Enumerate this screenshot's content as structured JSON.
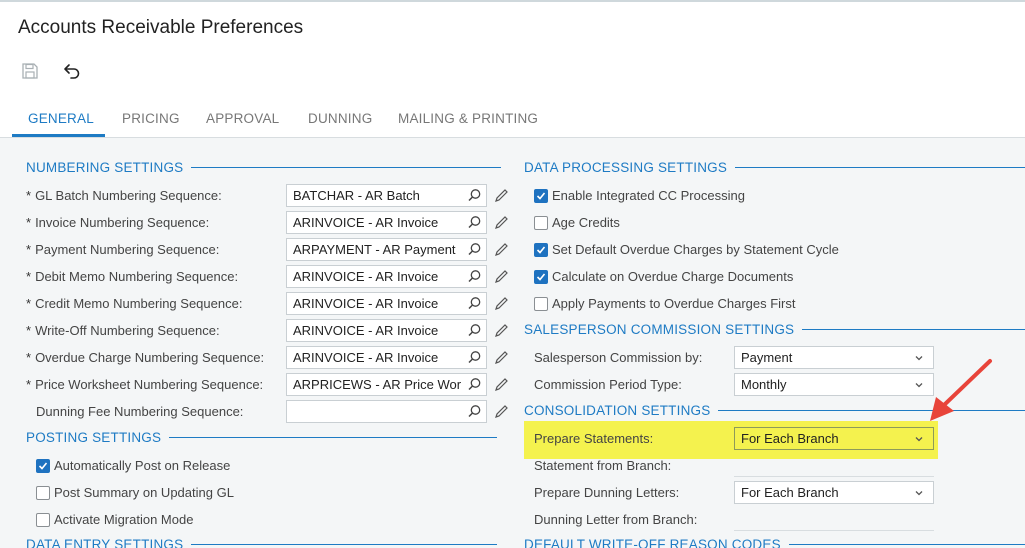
{
  "page": {
    "title": "Accounts Receivable Preferences"
  },
  "toolbar": {
    "save_icon": "save-icon",
    "undo_icon": "undo-icon"
  },
  "tabs": [
    {
      "label": "GENERAL",
      "active": true
    },
    {
      "label": "PRICING",
      "active": false
    },
    {
      "label": "APPROVAL",
      "active": false
    },
    {
      "label": "DUNNING",
      "active": false
    },
    {
      "label": "MAILING & PRINTING",
      "active": false
    }
  ],
  "numbering": {
    "title": "NUMBERING SETTINGS",
    "required_marker": "*",
    "rows": [
      {
        "label": "GL Batch Numbering Sequence:",
        "value": "BATCHAR - AR Batch",
        "required": true
      },
      {
        "label": "Invoice Numbering Sequence:",
        "value": "ARINVOICE - AR Invoice",
        "required": true
      },
      {
        "label": "Payment Numbering Sequence:",
        "value": "ARPAYMENT - AR Payment",
        "required": true
      },
      {
        "label": "Debit Memo Numbering Sequence:",
        "value": "ARINVOICE - AR Invoice",
        "required": true
      },
      {
        "label": "Credit Memo Numbering Sequence:",
        "value": "ARINVOICE - AR Invoice",
        "required": true
      },
      {
        "label": "Write-Off Numbering Sequence:",
        "value": "ARINVOICE - AR Invoice",
        "required": true
      },
      {
        "label": "Overdue Charge Numbering Sequence:",
        "value": "ARINVOICE - AR Invoice",
        "required": true
      },
      {
        "label": "Price Worksheet Numbering Sequence:",
        "value": "ARPRICEWS - AR Price Wor",
        "required": true
      },
      {
        "label": "Dunning Fee Numbering Sequence:",
        "value": "",
        "required": false
      }
    ]
  },
  "posting": {
    "title": "POSTING SETTINGS",
    "items": [
      {
        "label": "Automatically Post on Release",
        "checked": true
      },
      {
        "label": "Post Summary on Updating GL",
        "checked": false
      },
      {
        "label": "Activate Migration Mode",
        "checked": false
      }
    ]
  },
  "data_entry": {
    "title": "DATA ENTRY SETTINGS"
  },
  "data_processing": {
    "title": "DATA PROCESSING SETTINGS",
    "items": [
      {
        "label": "Enable Integrated CC Processing",
        "checked": true
      },
      {
        "label": "Age Credits",
        "checked": false
      },
      {
        "label": "Set Default Overdue Charges by Statement Cycle",
        "checked": true
      },
      {
        "label": "Calculate on Overdue Charge Documents",
        "checked": true
      },
      {
        "label": "Apply Payments to Overdue Charges First",
        "checked": false
      }
    ]
  },
  "salesperson": {
    "title": "SALESPERSON COMMISSION SETTINGS",
    "commission_by": {
      "label": "Salesperson Commission by:",
      "value": "Payment"
    },
    "period_type": {
      "label": "Commission Period Type:",
      "value": "Monthly"
    }
  },
  "consolidation": {
    "title": "CONSOLIDATION SETTINGS",
    "prepare_statements": {
      "label": "Prepare Statements:",
      "value": "For Each Branch"
    },
    "statement_from_branch": {
      "label": "Statement from Branch:",
      "value": ""
    },
    "prepare_dunning": {
      "label": "Prepare Dunning Letters:",
      "value": "For Each Branch"
    },
    "dunning_from_branch": {
      "label": "Dunning Letter from Branch:",
      "value": ""
    }
  },
  "writeoff": {
    "title": "DEFAULT WRITE-OFF REASON CODES"
  },
  "colors": {
    "accent": "#1e7bc4",
    "highlight": "#f4f24e",
    "arrow": "#e8443a",
    "checkbox": "#1e72c0"
  }
}
